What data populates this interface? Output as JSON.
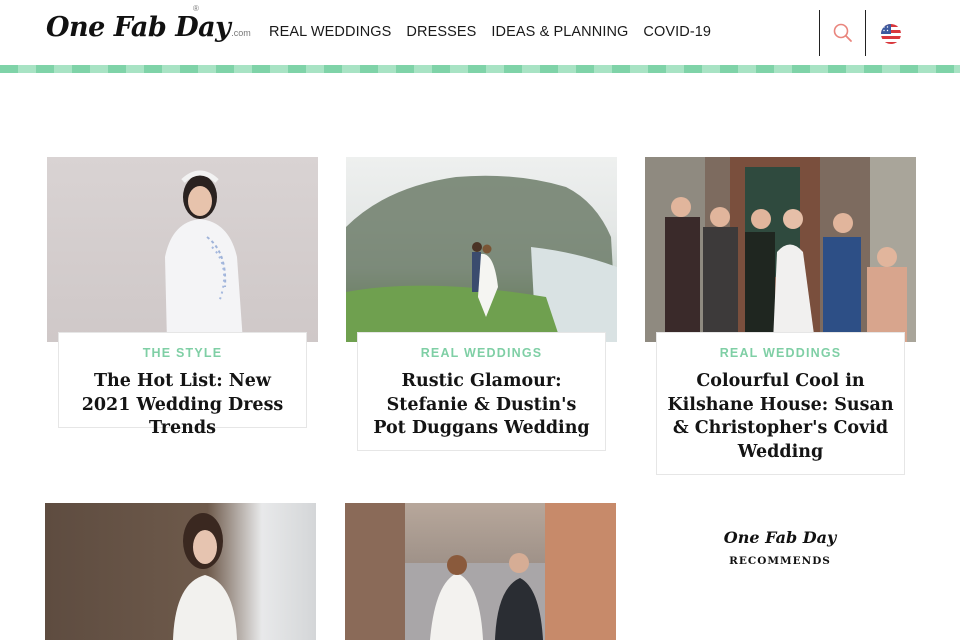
{
  "header": {
    "logo": {
      "text": "One Fab Day",
      "suffix": ".com",
      "registered": "®"
    },
    "nav": [
      {
        "label": "REAL WEDDINGS"
      },
      {
        "label": "DRESSES"
      },
      {
        "label": "IDEAS & PLANNING"
      },
      {
        "label": "COVID-19"
      }
    ],
    "icons": {
      "search": "search-icon",
      "flag": "us-flag-icon"
    },
    "colors": {
      "accent": "#7fd3a8",
      "search_icon": "#e9857d"
    }
  },
  "cards": [
    {
      "category": "THE STYLE",
      "title": "The Hot List: New 2021 Wedding Dress Trends"
    },
    {
      "category": "REAL WEDDINGS",
      "title": "Rustic Glamour: Stefanie & Dustin's Pot Duggans Wedding"
    },
    {
      "category": "REAL WEDDINGS",
      "title": "Colourful Cool in Kilshane House: Susan & Christopher's Covid Wedding"
    }
  ],
  "recommends": {
    "logo": "One Fab Day",
    "label": "RECOMMENDS"
  }
}
